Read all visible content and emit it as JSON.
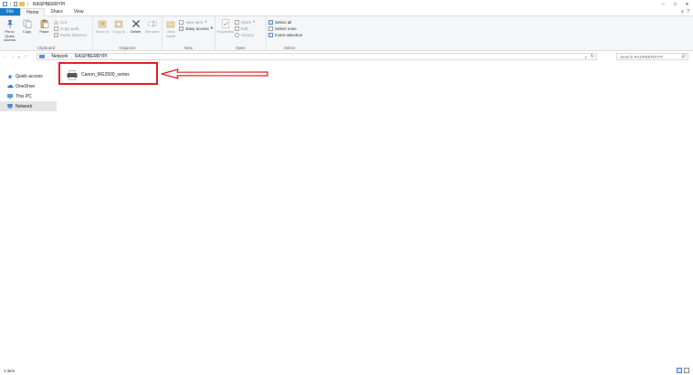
{
  "window": {
    "title": "RASPBERRYPI",
    "controls": {
      "minimize": "–",
      "maximize": "□",
      "close": "✕"
    }
  },
  "tabs": [
    {
      "label": "File"
    },
    {
      "label": "Home"
    },
    {
      "label": "Share"
    },
    {
      "label": "View"
    }
  ],
  "tabs_right": {
    "collapse": "∨",
    "help": "?"
  },
  "ribbon": {
    "clipboard": {
      "label": "Clipboard",
      "pin": "Pin to Quick access",
      "copy": "Copy",
      "paste": "Paste",
      "cut": "Cut",
      "copy_path": "Copy path",
      "paste_shortcut": "Paste shortcut"
    },
    "organize": {
      "label": "Organize",
      "move_to": "Move to",
      "copy_to": "Copy to",
      "delete": "Delete",
      "rename": "Rename"
    },
    "new": {
      "label": "New",
      "new_folder": "New folder",
      "new_item": "New item",
      "easy_access": "Easy access"
    },
    "open": {
      "label": "Open",
      "properties": "Properties",
      "open": "Open",
      "edit": "Edit",
      "history": "History"
    },
    "select": {
      "label": "Select",
      "select_all": "Select all",
      "select_none": "Select none",
      "invert_selection": "Invert selection"
    }
  },
  "address": {
    "back": "←",
    "forward": "→",
    "recent": "∨",
    "up": "↑",
    "crumbs": [
      "Network",
      "RASPBERRYPI"
    ],
    "separator": "›",
    "dropdown": "∨",
    "refresh": "↻"
  },
  "search": {
    "placeholder": "Search RASPBERRYPI",
    "icon": "search-icon"
  },
  "nav": [
    {
      "label": "Quick access",
      "icon": "star-icon"
    },
    {
      "label": "OneDrive",
      "icon": "cloud-icon"
    },
    {
      "label": "This PC",
      "icon": "computer-icon"
    },
    {
      "label": "Network",
      "icon": "network-icon"
    }
  ],
  "content": {
    "items": [
      {
        "label": "Canon_MG2500_series",
        "icon": "printer-icon"
      }
    ]
  },
  "annotation": {
    "box_color": "#e21f26",
    "arrow_color": "#e21f26"
  },
  "status": {
    "count": "1 item"
  },
  "colors": {
    "file_tab": "#1979ca",
    "ribbon_bg": "#f5f6f7",
    "selected_nav": "#e5e5e5"
  }
}
